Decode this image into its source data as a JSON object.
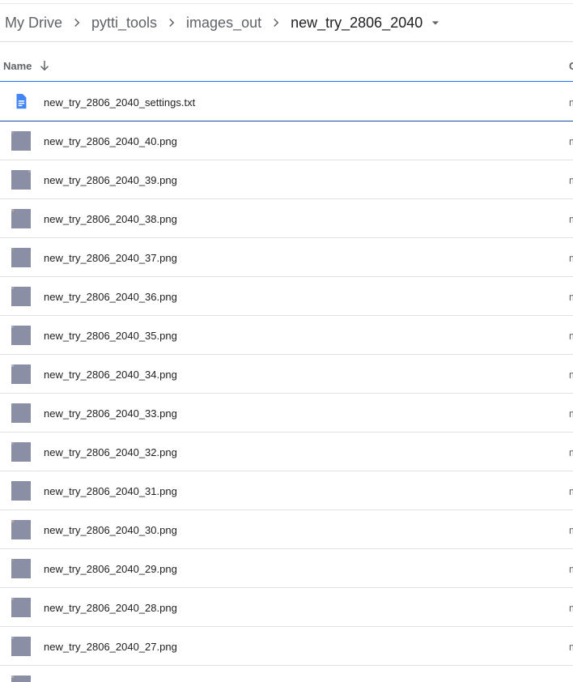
{
  "breadcrumb": {
    "items": [
      "My Drive",
      "pytti_tools",
      "images_out"
    ],
    "current": "new_try_2806_2040"
  },
  "header": {
    "name_label": "Name",
    "owner_label": "O"
  },
  "files": [
    {
      "name": "new_try_2806_2040_settings.txt",
      "type": "doc",
      "owner": "m"
    },
    {
      "name": "new_try_2806_2040_40.png",
      "type": "image",
      "owner": "m"
    },
    {
      "name": "new_try_2806_2040_39.png",
      "type": "image",
      "owner": "m"
    },
    {
      "name": "new_try_2806_2040_38.png",
      "type": "image",
      "owner": "m"
    },
    {
      "name": "new_try_2806_2040_37.png",
      "type": "image",
      "owner": "m"
    },
    {
      "name": "new_try_2806_2040_36.png",
      "type": "image",
      "owner": "m"
    },
    {
      "name": "new_try_2806_2040_35.png",
      "type": "image",
      "owner": "m"
    },
    {
      "name": "new_try_2806_2040_34.png",
      "type": "image",
      "owner": "m"
    },
    {
      "name": "new_try_2806_2040_33.png",
      "type": "image",
      "owner": "m"
    },
    {
      "name": "new_try_2806_2040_32.png",
      "type": "image",
      "owner": "m"
    },
    {
      "name": "new_try_2806_2040_31.png",
      "type": "image",
      "owner": "m"
    },
    {
      "name": "new_try_2806_2040_30.png",
      "type": "image",
      "owner": "m"
    },
    {
      "name": "new_try_2806_2040_29.png",
      "type": "image",
      "owner": "m"
    },
    {
      "name": "new_try_2806_2040_28.png",
      "type": "image",
      "owner": "m"
    },
    {
      "name": "new_try_2806_2040_27.png",
      "type": "image",
      "owner": "m"
    }
  ],
  "colors": {
    "accent": "#1a73e8",
    "doc_icon": "#4285f4"
  }
}
